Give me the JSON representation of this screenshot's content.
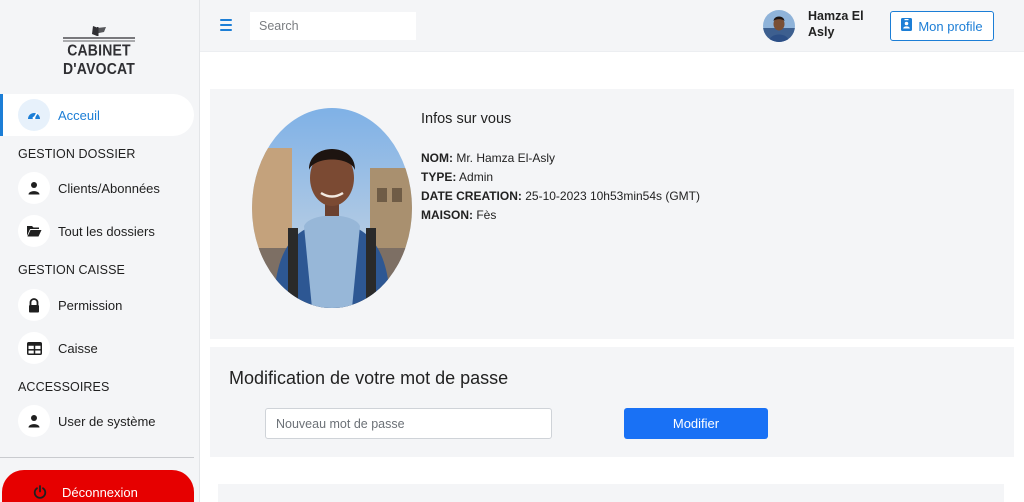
{
  "app": {
    "logo_text": "CABINET D'AVOCAT"
  },
  "sidebar": {
    "active": {
      "label": "Acceuil",
      "icon": "dashboard-gauge-icon"
    },
    "sections": [
      {
        "label": "GESTION DOSSIER",
        "items": [
          {
            "label": "Clients/Abonnées",
            "icon": "user-icon"
          },
          {
            "label": "Tout les dossiers",
            "icon": "folder-open-icon"
          }
        ]
      },
      {
        "label": "GESTION CAISSE",
        "items": [
          {
            "label": "Permission",
            "icon": "lock-icon"
          },
          {
            "label": "Caisse",
            "icon": "table-icon"
          }
        ]
      },
      {
        "label": "ACCESSOIRES",
        "items": [
          {
            "label": "User de système",
            "icon": "user-icon"
          }
        ]
      }
    ],
    "logout": {
      "label": "Déconnexion",
      "icon": "power-icon"
    }
  },
  "header": {
    "search_placeholder": "Search",
    "user_name": "Hamza El Asly",
    "profile_button": "Mon profile"
  },
  "info": {
    "title": "Infos sur vous",
    "rows": [
      {
        "label": "NOM:",
        "value": "Mr. Hamza El-Asly"
      },
      {
        "label": "TYPE:",
        "value": "Admin"
      },
      {
        "label": "DATE CREATION:",
        "value": "25-10-2023 10h53min54s (GMT)"
      },
      {
        "label": "MAISON:",
        "value": "Fès"
      }
    ]
  },
  "password": {
    "title": "Modification de votre mot de passe",
    "placeholder": "Nouveau mot de passe",
    "button": "Modifier"
  },
  "colors": {
    "accent": "#1c7ed6",
    "primary_button": "#1971f5",
    "logout": "#e60000",
    "panel": "#f4f5f7"
  }
}
